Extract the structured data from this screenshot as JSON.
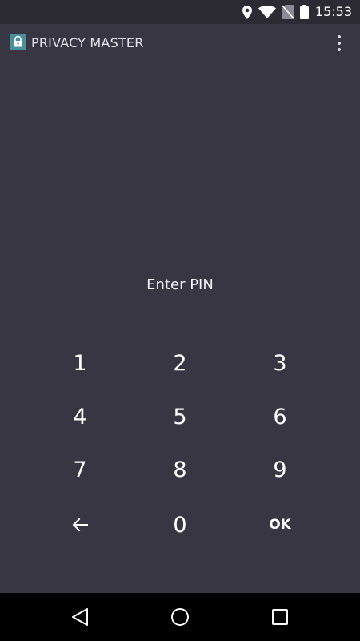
{
  "status_bar": {
    "time": "15:53",
    "icons": [
      "location-icon",
      "wifi-icon",
      "no-sim-icon",
      "battery-icon"
    ]
  },
  "app_bar": {
    "title": "PRIVACY MASTER",
    "icon": "lock-icon",
    "menu_icon": "more-vert-icon"
  },
  "pin": {
    "prompt": "Enter PIN"
  },
  "keypad": {
    "keys": [
      "1",
      "2",
      "3",
      "4",
      "5",
      "6",
      "7",
      "8",
      "9",
      "",
      "0",
      "OK"
    ],
    "backspace_icon": "backspace-arrow-icon"
  },
  "nav_bar": {
    "icons": [
      "back-icon",
      "home-icon",
      "recents-icon"
    ]
  },
  "colors": {
    "background": "#383643",
    "status_bar": "#2c2a33",
    "nav_bar": "#000000",
    "app_icon": "#4a8f9a",
    "text": "#ffffff"
  }
}
